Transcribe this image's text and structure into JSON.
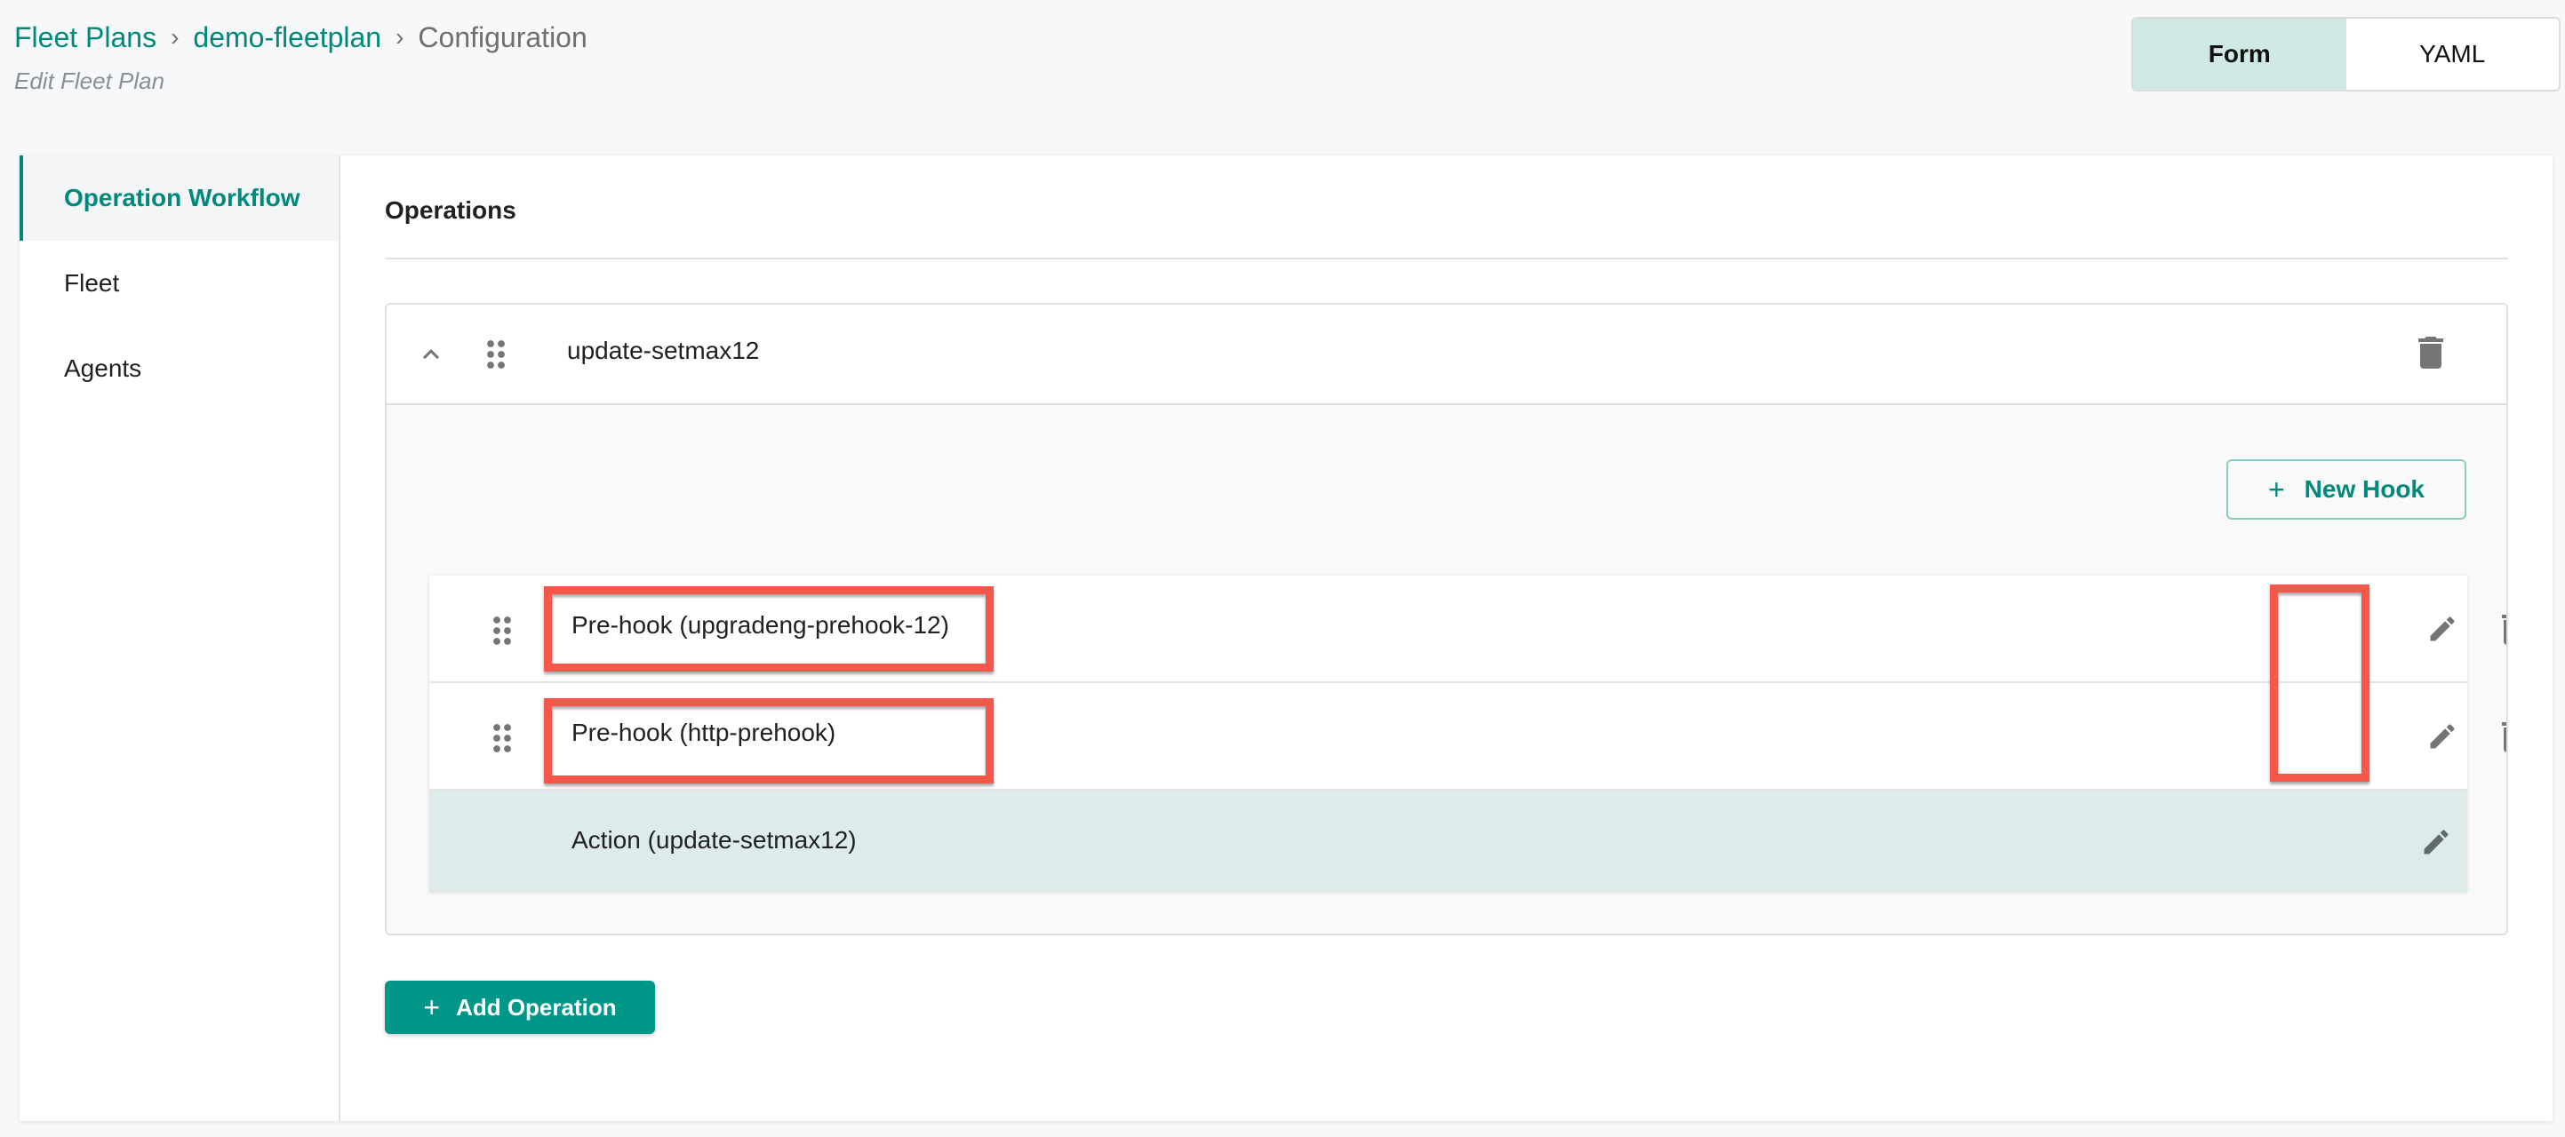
{
  "breadcrumb": {
    "items": [
      {
        "label": "Fleet Plans"
      },
      {
        "label": "demo-fleetplan"
      },
      {
        "label": "Configuration"
      }
    ],
    "separator": "›"
  },
  "subtitle": "Edit Fleet Plan",
  "view_toggle": {
    "options": [
      {
        "label": "Form",
        "active": true
      },
      {
        "label": "YAML",
        "active": false
      }
    ]
  },
  "sidebar": {
    "items": [
      {
        "label": "Operation Workflow",
        "active": true
      },
      {
        "label": "Fleet",
        "active": false
      },
      {
        "label": "Agents",
        "active": false
      }
    ]
  },
  "main": {
    "section_title": "Operations",
    "operations": [
      {
        "name": "update-setmax12",
        "expanded": true,
        "new_hook_label": "New Hook",
        "hooks": [
          {
            "label": "Pre-hook (upgradeng-prehook-12)",
            "highlighted": true
          },
          {
            "label": "Pre-hook (http-prehook)",
            "highlighted": true
          }
        ],
        "action": {
          "label": "Action (update-setmax12)"
        }
      }
    ],
    "add_operation_label": "Add Operation"
  },
  "icons": {
    "chevron": "chevron-up-icon",
    "drag": "drag-handle-icon",
    "edit": "pencil-icon",
    "delete": "trash-icon",
    "add": "plus-icon"
  },
  "colors": {
    "accent": "#00897b",
    "button_primary": "#009688",
    "toggle_active_bg": "#cfe9e5",
    "action_row_bg": "#ddecea",
    "annotation": "#f5574b",
    "icon_gray": "#757575"
  }
}
